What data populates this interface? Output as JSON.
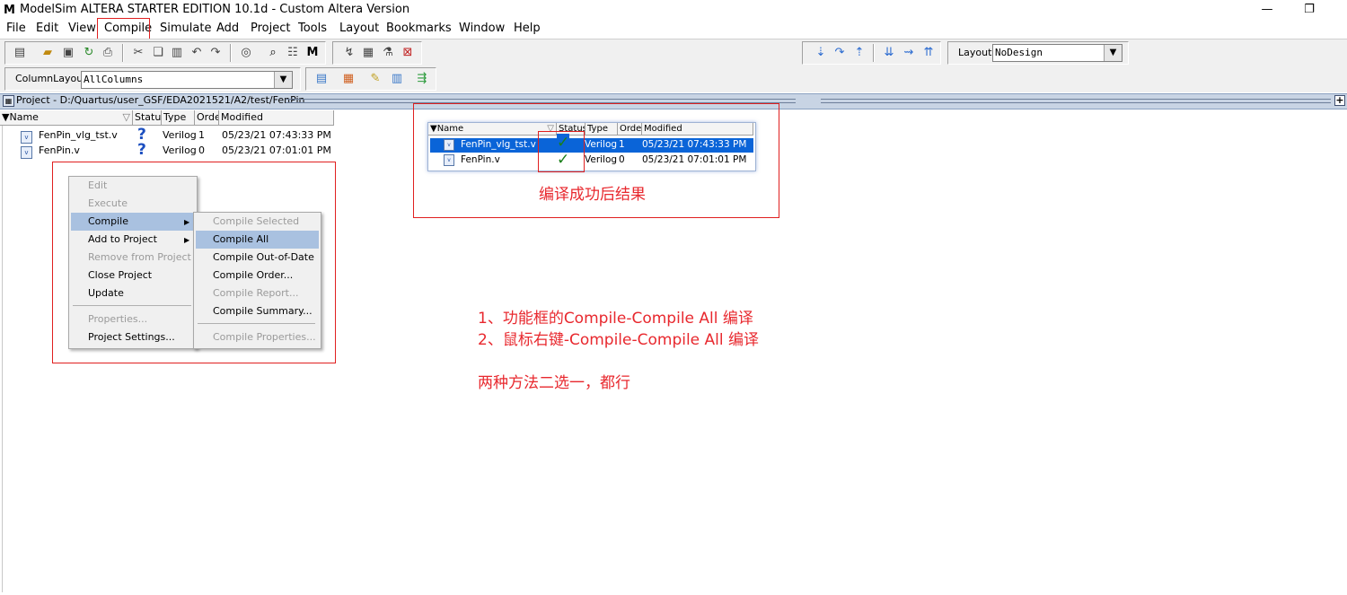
{
  "window": {
    "title": "ModelSim ALTERA STARTER EDITION 10.1d - Custom Altera Version",
    "logo": "M",
    "minimize": "—",
    "restore": "❐"
  },
  "menubar": [
    "File",
    "Edit",
    "View",
    "Compile",
    "Simulate",
    "Add",
    "Project",
    "Tools",
    "Layout",
    "Bookmarks",
    "Window",
    "Help"
  ],
  "toolbar": {
    "layout_label": "Layout",
    "layout_value": "NoDesign",
    "column_layout_label": "ColumnLayout",
    "column_layout_value": "AllColumns"
  },
  "project": {
    "title": "Project - D:/Quartus/user_GSF/EDA2021521/A2/test/FenPin",
    "columns": [
      "Name",
      "Status",
      "Type",
      "Order",
      "Modified"
    ],
    "files": [
      {
        "name": "FenPin_vlg_tst.v",
        "status": "?",
        "type": "Verilog",
        "order": "1",
        "modified": "05/23/21 07:43:33 PM"
      },
      {
        "name": "FenPin.v",
        "status": "?",
        "type": "Verilog",
        "order": "0",
        "modified": "05/23/21 07:01:01 PM"
      }
    ]
  },
  "context_menu": {
    "items": [
      {
        "label": "Edit",
        "enabled": false
      },
      {
        "label": "Execute",
        "enabled": false
      },
      {
        "label": "Compile",
        "enabled": true,
        "highlighted": true,
        "submenu": true
      },
      {
        "label": "Add to Project",
        "enabled": true,
        "submenu": true
      },
      {
        "label": "Remove from Project",
        "enabled": false
      },
      {
        "label": "Close Project",
        "enabled": true
      },
      {
        "label": "Update",
        "enabled": true
      },
      {
        "label": "Properties...",
        "enabled": false
      },
      {
        "label": "Project Settings...",
        "enabled": true
      }
    ],
    "submenu": [
      {
        "label": "Compile Selected",
        "enabled": false
      },
      {
        "label": "Compile All",
        "enabled": true,
        "highlighted": true
      },
      {
        "label": "Compile Out-of-Date",
        "enabled": true
      },
      {
        "label": "Compile Order...",
        "enabled": true
      },
      {
        "label": "Compile Report...",
        "enabled": false
      },
      {
        "label": "Compile Summary...",
        "enabled": true
      },
      {
        "label": "Compile Properties...",
        "enabled": false
      }
    ]
  },
  "inset": {
    "columns": [
      "Name",
      "Status",
      "Type",
      "Order",
      "Modified"
    ],
    "files": [
      {
        "name": "FenPin_vlg_tst.v",
        "status": "✓",
        "type": "Verilog",
        "order": "1",
        "modified": "05/23/21 07:43:33 PM"
      },
      {
        "name": "FenPin.v",
        "status": "✓",
        "type": "Verilog",
        "order": "0",
        "modified": "05/23/21 07:01:01 PM"
      }
    ],
    "caption": "编译成功后结果"
  },
  "notes": {
    "line1": "1、功能框的Compile-Compile All  编译",
    "line2": "2、鼠标右键-Compile-Compile All 编译",
    "line3": "两种方法二选一，都行"
  },
  "colors": {
    "annotation_red": "#e02020",
    "selection_blue": "#0a64d8",
    "menu_highlight": "#a9c1e0",
    "success_green": "#1a7f1a",
    "unknown_blue": "#1c4fc0"
  }
}
